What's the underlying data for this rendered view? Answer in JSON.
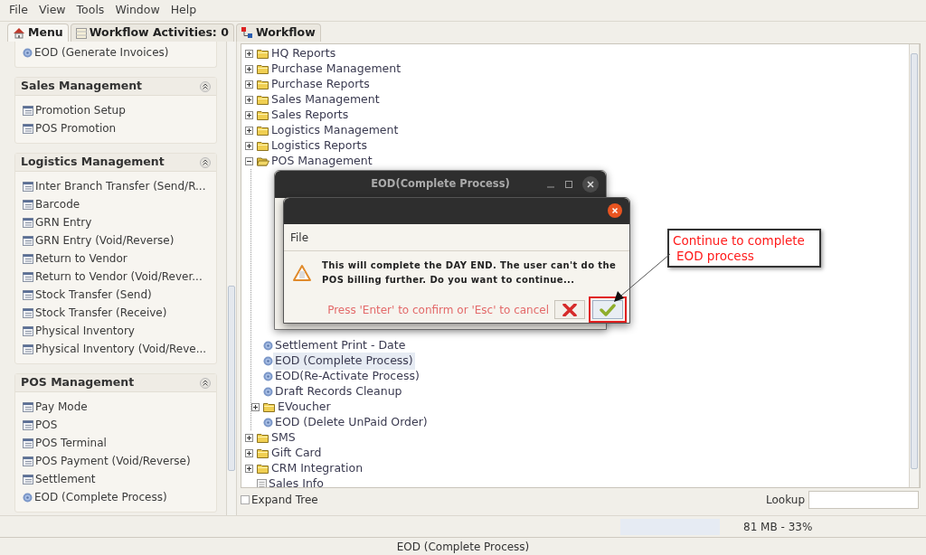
{
  "menubar": [
    "File",
    "View",
    "Tools",
    "Window",
    "Help"
  ],
  "tabs": [
    {
      "label": "Menu",
      "selected": true
    },
    {
      "label": "Workflow Activities: 0",
      "selected": false
    },
    {
      "label": "Workflow",
      "selected": false
    }
  ],
  "sidebar": {
    "sections": [
      {
        "items": [
          {
            "label": "EOD (Generate Invoices)",
            "kind": "action"
          }
        ]
      },
      {
        "title": "Sales Management",
        "items": [
          {
            "label": "Promotion Setup",
            "kind": "form"
          },
          {
            "label": "POS Promotion",
            "kind": "form"
          }
        ]
      },
      {
        "title": "Logistics Management",
        "items": [
          {
            "label": "Inter Branch Transfer (Send/R...",
            "kind": "form"
          },
          {
            "label": "Barcode",
            "kind": "form"
          },
          {
            "label": "GRN Entry",
            "kind": "form"
          },
          {
            "label": "GRN Entry (Void/Reverse)",
            "kind": "form"
          },
          {
            "label": "Return to Vendor",
            "kind": "form"
          },
          {
            "label": "Return to Vendor (Void/Rever...",
            "kind": "form"
          },
          {
            "label": "Stock Transfer (Send)",
            "kind": "form"
          },
          {
            "label": "Stock Transfer (Receive)",
            "kind": "form"
          },
          {
            "label": "Physical Inventory",
            "kind": "form"
          },
          {
            "label": "Physical Inventory (Void/Reve...",
            "kind": "form"
          }
        ]
      },
      {
        "title": "POS Management",
        "items": [
          {
            "label": "Pay Mode",
            "kind": "form"
          },
          {
            "label": "POS",
            "kind": "form"
          },
          {
            "label": "POS Terminal",
            "kind": "form"
          },
          {
            "label": "POS Payment (Void/Reverse)",
            "kind": "form"
          },
          {
            "label": "Settlement",
            "kind": "form"
          },
          {
            "label": "EOD (Complete Process)",
            "kind": "action"
          }
        ]
      }
    ]
  },
  "tree": {
    "nodes": [
      {
        "label": "HQ Reports",
        "kind": "folder",
        "expanded": false,
        "selected": false
      },
      {
        "label": "Purchase Management",
        "kind": "folder",
        "expanded": false,
        "selected": false
      },
      {
        "label": "Purchase Reports",
        "kind": "folder",
        "expanded": false,
        "selected": false
      },
      {
        "label": "Sales Management",
        "kind": "folder",
        "expanded": false,
        "selected": false
      },
      {
        "label": "Sales Reports",
        "kind": "folder",
        "expanded": false,
        "selected": false
      },
      {
        "label": "Logistics Management",
        "kind": "folder",
        "expanded": false,
        "selected": false
      },
      {
        "label": "Logistics Reports",
        "kind": "folder",
        "expanded": false,
        "selected": false
      },
      {
        "label": "POS Management",
        "kind": "folder",
        "expanded": true,
        "selected": false,
        "children": [
          {
            "label": "Settlement Print - Date",
            "kind": "action",
            "selected": false
          },
          {
            "label": "EOD (Complete Process)",
            "kind": "action",
            "selected": true
          },
          {
            "label": "EOD(Re-Activate Process)",
            "kind": "action",
            "selected": false
          },
          {
            "label": "Draft Records Cleanup",
            "kind": "action",
            "selected": false
          },
          {
            "label": "EVoucher",
            "kind": "folder",
            "expanded": false,
            "selected": false
          },
          {
            "label": "EOD (Delete UnPaid Order)",
            "kind": "action",
            "selected": false
          }
        ]
      },
      {
        "label": "SMS",
        "kind": "folder",
        "expanded": false,
        "selected": false
      },
      {
        "label": "Gift Card",
        "kind": "folder",
        "expanded": false,
        "selected": false
      },
      {
        "label": "CRM Integration",
        "kind": "folder",
        "expanded": false,
        "selected": false
      },
      {
        "label": "Sales Info",
        "kind": "document",
        "selected": false
      }
    ]
  },
  "expand_tree": {
    "label": "Expand Tree",
    "checked": false
  },
  "lookup": {
    "label": "Lookup"
  },
  "memory": {
    "text": "81 MB - 33%"
  },
  "status_bar": "EOD (Complete Process)",
  "back_dialog": {
    "title": "EOD(Complete Process)"
  },
  "dialog": {
    "menu": [
      "File"
    ],
    "message": "This will complete the DAY END. The user can't do the POS billing further. Do you want to continue...",
    "hint": "Press 'Enter' to confirm or 'Esc' to cancel"
  },
  "annotation": {
    "lines": [
      "Continue to complete",
      "EOD process"
    ]
  }
}
